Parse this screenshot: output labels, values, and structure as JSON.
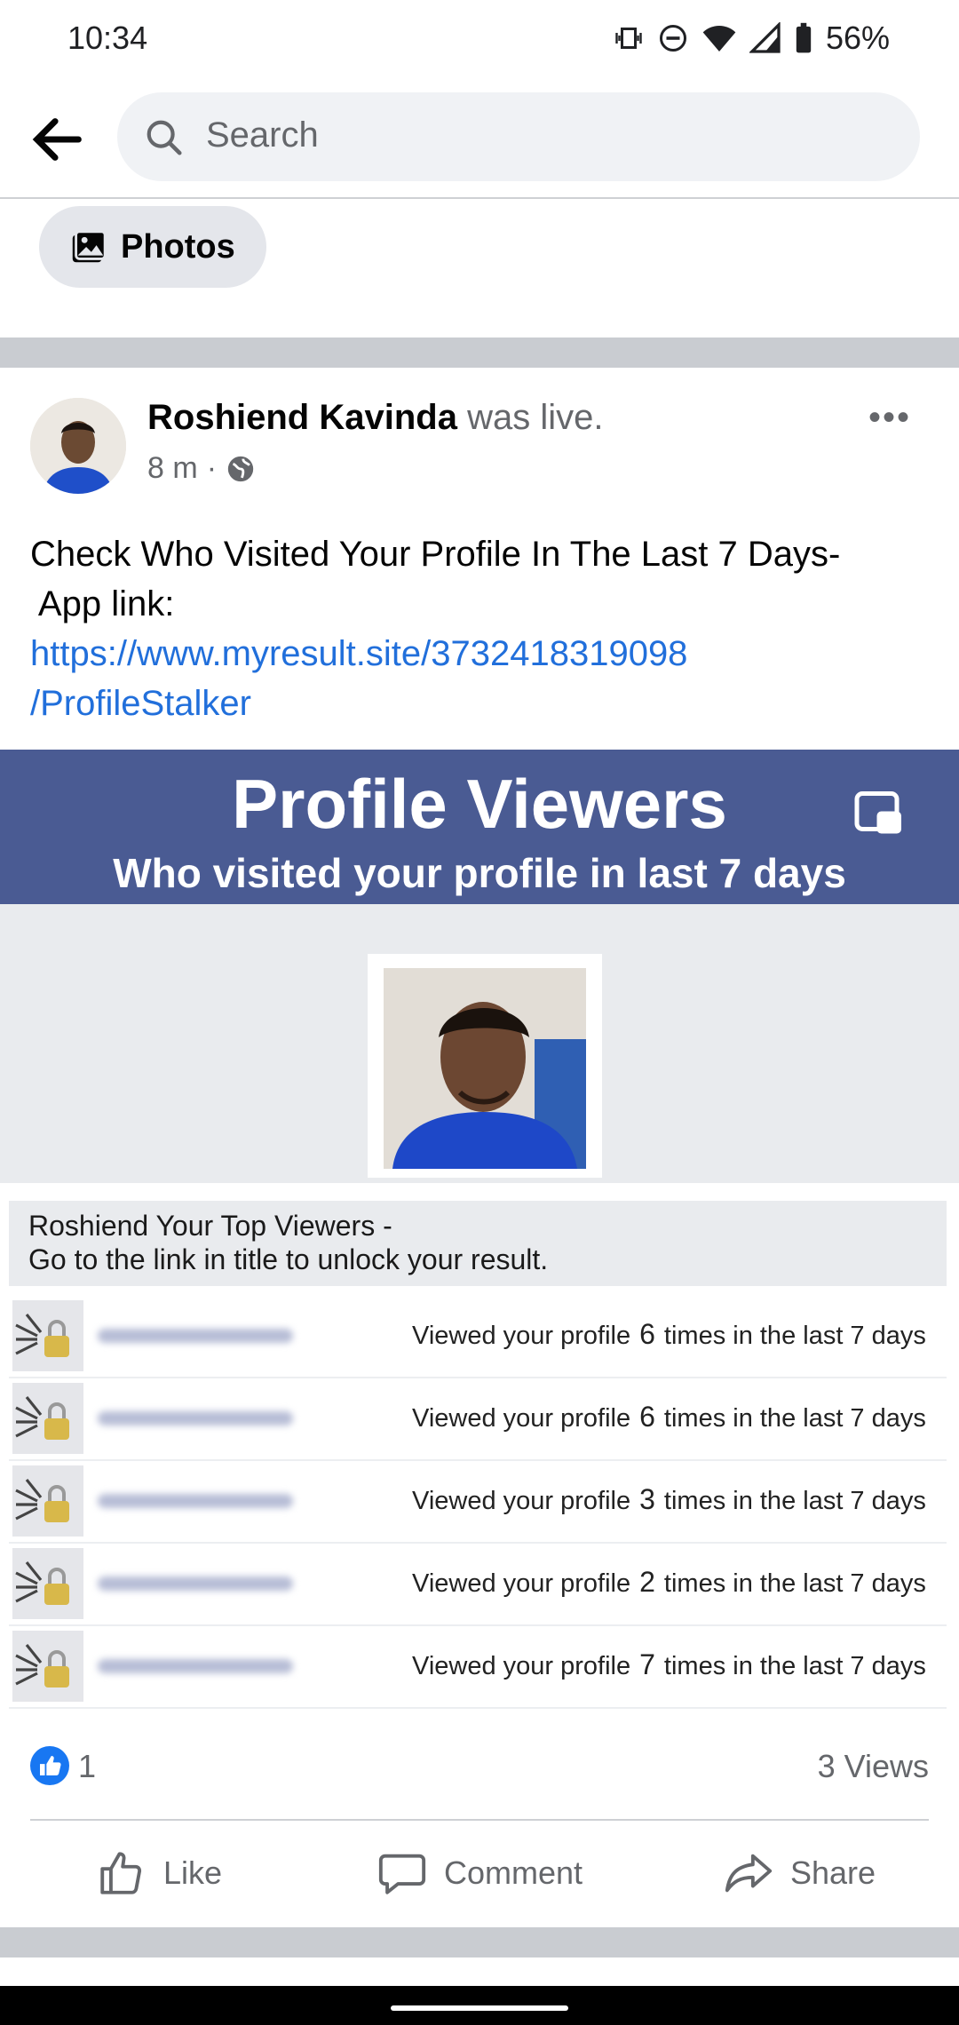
{
  "status_bar": {
    "time": "10:34",
    "battery": "56%"
  },
  "search": {
    "placeholder": "Search"
  },
  "filter_chip": {
    "label": "Photos"
  },
  "post": {
    "author": "Roshiend Kavinda",
    "action": " was live.",
    "time": "8 m",
    "text_line1": "Check Who Visited Your Profile In The Last 7 Days-",
    "text_line2": " App link:",
    "link_line1": "https://www.myresult.site/3732418319098",
    "link_line2": "/ProfileStalker",
    "preview": {
      "title": "Profile Viewers",
      "subtitle": "Who visited your profile in last 7 days",
      "notice_line1": "Roshiend Your Top Viewers -",
      "notice_line2": "Go to the link in title to unlock your result.",
      "rows": [
        {
          "prefix": "Viewed your profile",
          "count": "6",
          "suffix": "times in the last 7 days"
        },
        {
          "prefix": "Viewed your profile",
          "count": "6",
          "suffix": "times in the last 7 days"
        },
        {
          "prefix": "Viewed your profile",
          "count": "3",
          "suffix": "times in the last 7 days"
        },
        {
          "prefix": "Viewed your profile",
          "count": "2",
          "suffix": "times in the last 7 days"
        },
        {
          "prefix": "Viewed your profile",
          "count": "7",
          "suffix": "times in the last 7 days"
        }
      ]
    },
    "like_count": "1",
    "views": "3 Views",
    "actions": {
      "like": "Like",
      "comment": "Comment",
      "share": "Share"
    }
  },
  "colors": {
    "link": "#216fdb",
    "banner": "#4a5b93",
    "like_badge": "#1877f2"
  },
  "icons": [
    "back-arrow-icon",
    "search-icon",
    "photos-icon",
    "globe-icon",
    "more-icon",
    "pip-icon",
    "lock-icon",
    "like-badge-icon",
    "like-icon",
    "comment-icon",
    "share-icon"
  ]
}
